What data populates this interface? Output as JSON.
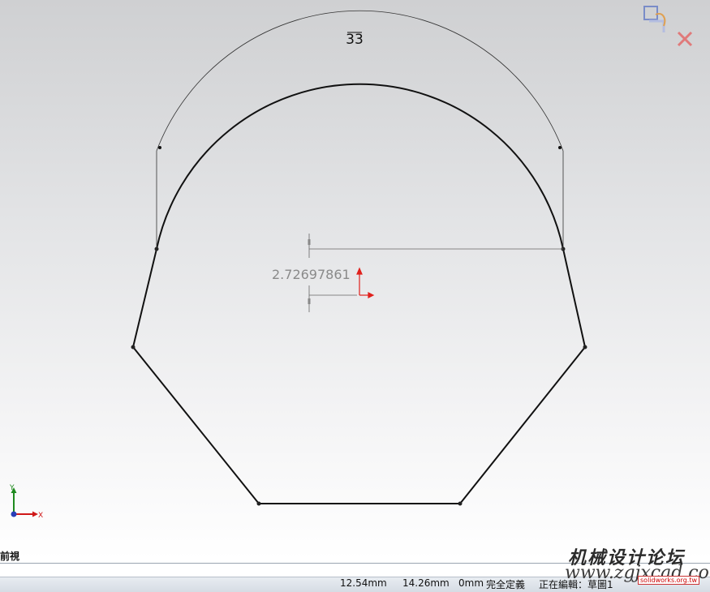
{
  "dimensions": {
    "arc_length": "33",
    "vertical_distance": "2.72697861"
  },
  "triad": {
    "y_label": "Y",
    "x_label": "X"
  },
  "view": {
    "name": "前視"
  },
  "statusbar": {
    "x_coord": "12.54mm",
    "y_coord": "14.26mm",
    "z_coord": "0mm",
    "constraint_status": "完全定義",
    "editing_status": "正在編輯：草圖1"
  },
  "watermark": {
    "line1": "机械设计论坛",
    "line2": "www.zgjxcad.com",
    "badge": "solidworks.org.tw"
  },
  "colors": {
    "sketch_line": "#111111",
    "dimension_line": "#555555",
    "origin_red": "#e0201c",
    "confirm_icon": "#7a8cc8",
    "cancel_icon": "#e07a7a"
  },
  "icons": {
    "confirm_corner": "sketch-exit-icon",
    "cancel_corner": "cancel-icon"
  }
}
